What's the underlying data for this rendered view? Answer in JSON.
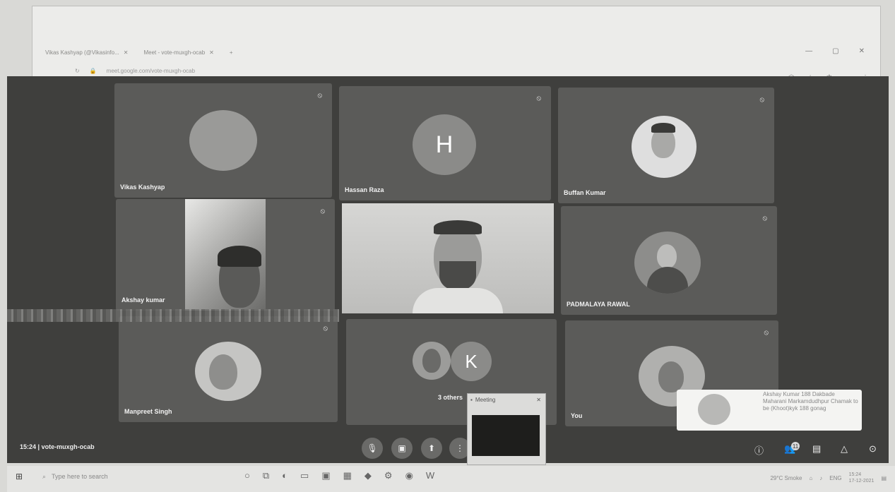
{
  "browser": {
    "tabs": [
      {
        "label": "Vikas Kashyap (@Vikasinfo..."
      },
      {
        "label": "Meet - vote-muxgh-ocab"
      }
    ],
    "address": "meet.google.com/vote-muxgh-ocab",
    "window_controls": [
      "—",
      "▢",
      "✕"
    ]
  },
  "participants": [
    {
      "name": "Vikas Kashyap",
      "avatar_type": "photo"
    },
    {
      "name": "Hassan Raza",
      "avatar_letter": "H"
    },
    {
      "name": "Buffan Kumar",
      "avatar_type": "photo"
    },
    {
      "name": "Akshay kumar",
      "avatar_type": "video"
    },
    {
      "name": "",
      "avatar_type": "video"
    },
    {
      "name": "PADMALAYA RAWAL",
      "avatar_type": "photo"
    },
    {
      "name": "Manpreet Singh",
      "avatar_type": "photo"
    },
    {
      "name": "3 others",
      "avatar_letter": "K"
    },
    {
      "name": "You",
      "avatar_type": "photo"
    }
  ],
  "meeting": {
    "time": "15:24",
    "code": "vote-muxgh-ocab",
    "people_badge": "11"
  },
  "notification": {
    "text": "Akshay Kumar 188 Dakbade Maharani Markamdudhpur Chamak to be (Khoot)kyk 188 gonag"
  },
  "mini_window": {
    "title": "Meeting"
  },
  "taskbar": {
    "search_placeholder": "Type here to search",
    "weather": "29°C Smoke",
    "time": "15:24",
    "date": "17-12-2021",
    "lang": "ENG"
  }
}
